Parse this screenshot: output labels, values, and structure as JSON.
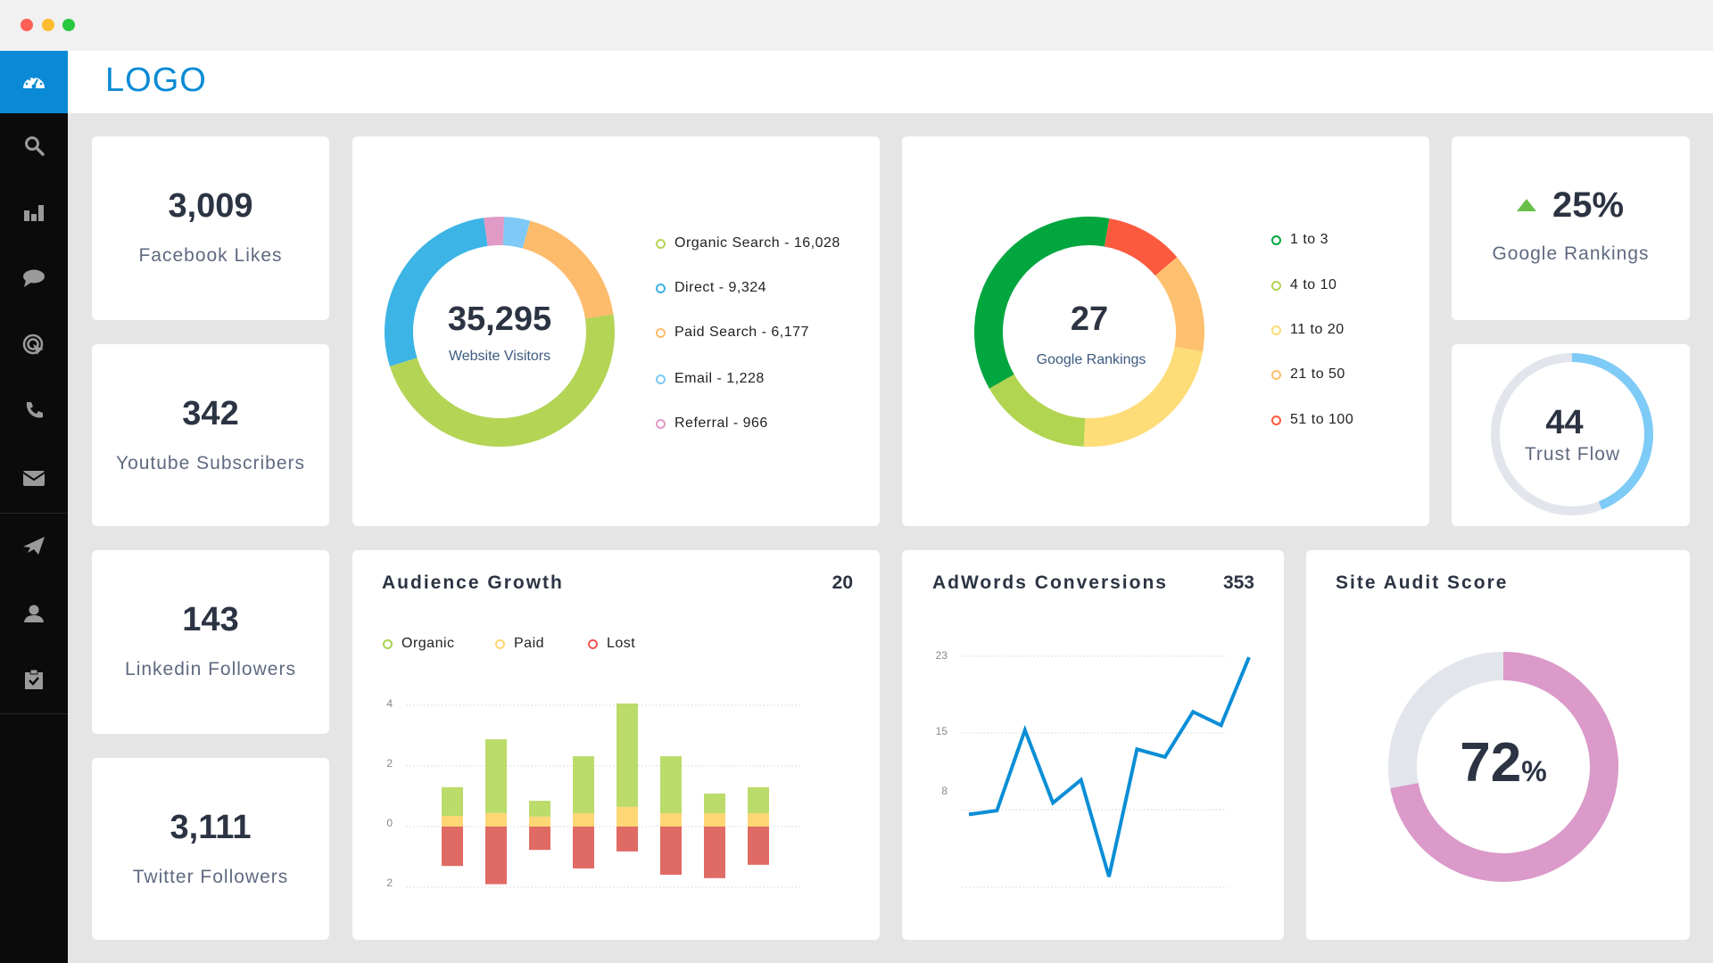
{
  "window": {
    "controls": [
      "close",
      "minimize",
      "maximize"
    ],
    "colors": {
      "close": "#fe5f57",
      "minimize": "#febc2e",
      "maximize": "#28c840"
    }
  },
  "header": {
    "logo": "LOGO"
  },
  "sidebar": {
    "items": [
      {
        "icon": "dashboard-icon",
        "active": true
      },
      {
        "icon": "search-icon"
      },
      {
        "icon": "bar-chart-icon"
      },
      {
        "icon": "chat-icon"
      },
      {
        "icon": "target-icon"
      },
      {
        "icon": "phone-icon"
      },
      {
        "icon": "mail-icon"
      },
      {
        "icon": "send-icon"
      },
      {
        "icon": "user-icon"
      },
      {
        "icon": "clipboard-check-icon"
      }
    ]
  },
  "stats": [
    {
      "value": "3,009",
      "label": "Facebook Likes"
    },
    {
      "value": "342",
      "label": "Youtube Subscribers"
    },
    {
      "value": "143",
      "label": "Linkedin Followers"
    },
    {
      "value": "3,111",
      "label": "Twitter Followers"
    }
  ],
  "rank_change": {
    "value": "25%",
    "label": "Google Rankings",
    "direction": "up",
    "color": "#6abf4b"
  },
  "trust_flow": {
    "value": "44",
    "label": "Trust Flow",
    "fill_percent": 44,
    "color": "#7ecbf7",
    "track": "#e2e5ec"
  },
  "site_audit": {
    "title": "Site Audit Score",
    "value": "72",
    "unit": "%",
    "fill_percent": 72,
    "color": "#db9ac9",
    "track": "#e2e5ec"
  },
  "chart_data": [
    {
      "type": "pie",
      "variant": "donut",
      "center_value": "35,295",
      "center_label": "Website Visitors",
      "slices": [
        {
          "name": "Referral",
          "value": 966,
          "label": "Referral - 966",
          "color": "#e09ac6"
        },
        {
          "name": "Email",
          "value": 1228,
          "label": "Email - 1,228",
          "color": "#7ec9f5"
        },
        {
          "name": "Paid Search",
          "value": 6177,
          "label": "Paid Search - 6,177",
          "color": "#fdbb6c"
        },
        {
          "name": "Organic Search",
          "value": 16028,
          "label": "Organic Search - 16,028",
          "color": "#b4d455"
        },
        {
          "name": "Direct",
          "value": 9324,
          "label": "Direct - 9,324",
          "color": "#3cb4e5"
        }
      ],
      "legend_order": [
        3,
        4,
        2,
        1,
        0
      ]
    },
    {
      "type": "pie",
      "variant": "donut",
      "center_value": "27",
      "center_label": "Google Rankings",
      "slices": [
        {
          "name": "51 to 100",
          "share": 0.11,
          "color": "#fb5a3e"
        },
        {
          "name": "21 to 50",
          "share": 0.14,
          "color": "#fdc06e"
        },
        {
          "name": "11 to 20",
          "share": 0.23,
          "color": "#fedc77"
        },
        {
          "name": "4 to 10",
          "share": 0.16,
          "color": "#b2d551"
        },
        {
          "name": "1 to 3",
          "share": 0.36,
          "color": "#02a63f"
        }
      ],
      "legend_order": [
        4,
        3,
        2,
        1,
        0
      ]
    },
    {
      "type": "bar",
      "stacked": true,
      "title": "Audience Growth",
      "total": "20",
      "ylim": [
        -2,
        4
      ],
      "yticks": [
        {
          "value": 4,
          "label": "4"
        },
        {
          "value": 2,
          "label": "2"
        },
        {
          "value": 0,
          "label": "0"
        },
        {
          "value": -2,
          "label": "2"
        }
      ],
      "grid": true,
      "legend": "top-left",
      "series": [
        {
          "name": "Organic",
          "color": "#bbdb6a",
          "values": [
            0.95,
            2.43,
            0.52,
            1.88,
            3.41,
            1.88,
            0.65,
            0.86
          ]
        },
        {
          "name": "Paid",
          "color": "#fed674",
          "values": [
            0.35,
            0.45,
            0.33,
            0.44,
            0.65,
            0.44,
            0.44,
            0.44
          ]
        },
        {
          "name": "Lost",
          "color": "#e06a64",
          "values": [
            -1.3,
            -1.9,
            -0.77,
            -1.38,
            -0.82,
            -1.59,
            -1.7,
            -1.26
          ]
        }
      ]
    },
    {
      "type": "line",
      "title": "AdWords Conversions",
      "total": "353",
      "ylim": [
        0,
        23
      ],
      "yticks": [
        "23",
        "15",
        "8"
      ],
      "grid": true,
      "color": "#0a8ed6",
      "values": [
        6.5,
        6.9,
        15.3,
        7.7,
        10.1,
        0,
        13.3,
        12.5,
        17.2,
        15.8,
        22.9
      ]
    }
  ]
}
